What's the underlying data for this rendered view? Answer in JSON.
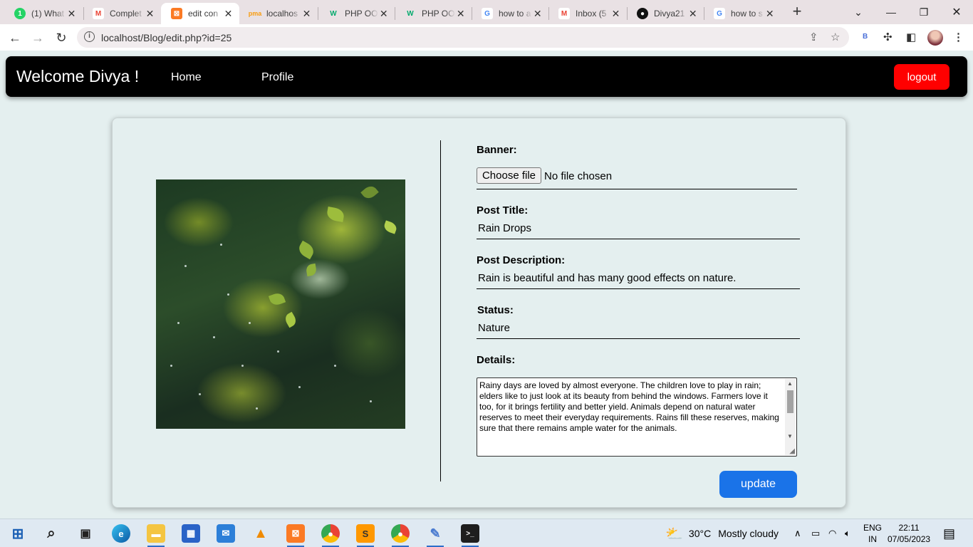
{
  "browser": {
    "tabs": [
      {
        "title": "(1) What",
        "favicon": "whatsapp-icon",
        "color": "#25d366",
        "glyph": "1"
      },
      {
        "title": "Complet",
        "favicon": "gmail-icon",
        "color": "#ea4335",
        "glyph": "M"
      },
      {
        "title": "edit con",
        "favicon": "xampp-icon",
        "color": "#fb7a24",
        "glyph": "X",
        "active": true
      },
      {
        "title": "localhos",
        "favicon": "phpmyadmin-icon",
        "color": "#f89c0e",
        "glyph": "p"
      },
      {
        "title": "PHP OO",
        "favicon": "w3schools-icon",
        "color": "#04aa6d",
        "glyph": "W"
      },
      {
        "title": "PHP OO",
        "favicon": "w3schools-icon",
        "color": "#04aa6d",
        "glyph": "W"
      },
      {
        "title": "how to a",
        "favicon": "google-icon",
        "color": "#4285f4",
        "glyph": "G"
      },
      {
        "title": "Inbox (5",
        "favicon": "gmail-icon",
        "color": "#ea4335",
        "glyph": "M"
      },
      {
        "title": "Divya21",
        "favicon": "github-icon",
        "color": "#111111",
        "glyph": "◉"
      },
      {
        "title": "how to s",
        "favicon": "google-icon",
        "color": "#4285f4",
        "glyph": "G"
      }
    ],
    "url": "localhost/Blog/edit.php?id=25"
  },
  "navbar": {
    "brand": "Welcome Divya !",
    "home": "Home",
    "profile": "Profile",
    "logout": "logout"
  },
  "form": {
    "banner_label": "Banner:",
    "choose_file": "Choose file",
    "file_status": "No file chosen",
    "title_label": "Post Title:",
    "title_value": "Rain Drops",
    "description_label": "Post Description:",
    "description_value": "Rain is beautiful and has many good effects on nature.",
    "status_label": "Status:",
    "status_value": "Nature",
    "details_label": "Details:",
    "details_value": "Rainy days are loved by almost everyone. The children love to play in rain; elders like to just look at its beauty from behind the windows. Farmers love it too, for it brings fertility and better yield. Animals depend on natural water reserves to meet their everyday requirements. Rains fill these reserves, making sure that there remains ample water for the animals.",
    "update": "update"
  },
  "taskbar": {
    "weather_temp": "30°C",
    "weather_desc": "Mostly cloudy",
    "lang_top": "ENG",
    "lang_bottom": "IN",
    "time": "22:11",
    "date": "07/05/2023"
  }
}
